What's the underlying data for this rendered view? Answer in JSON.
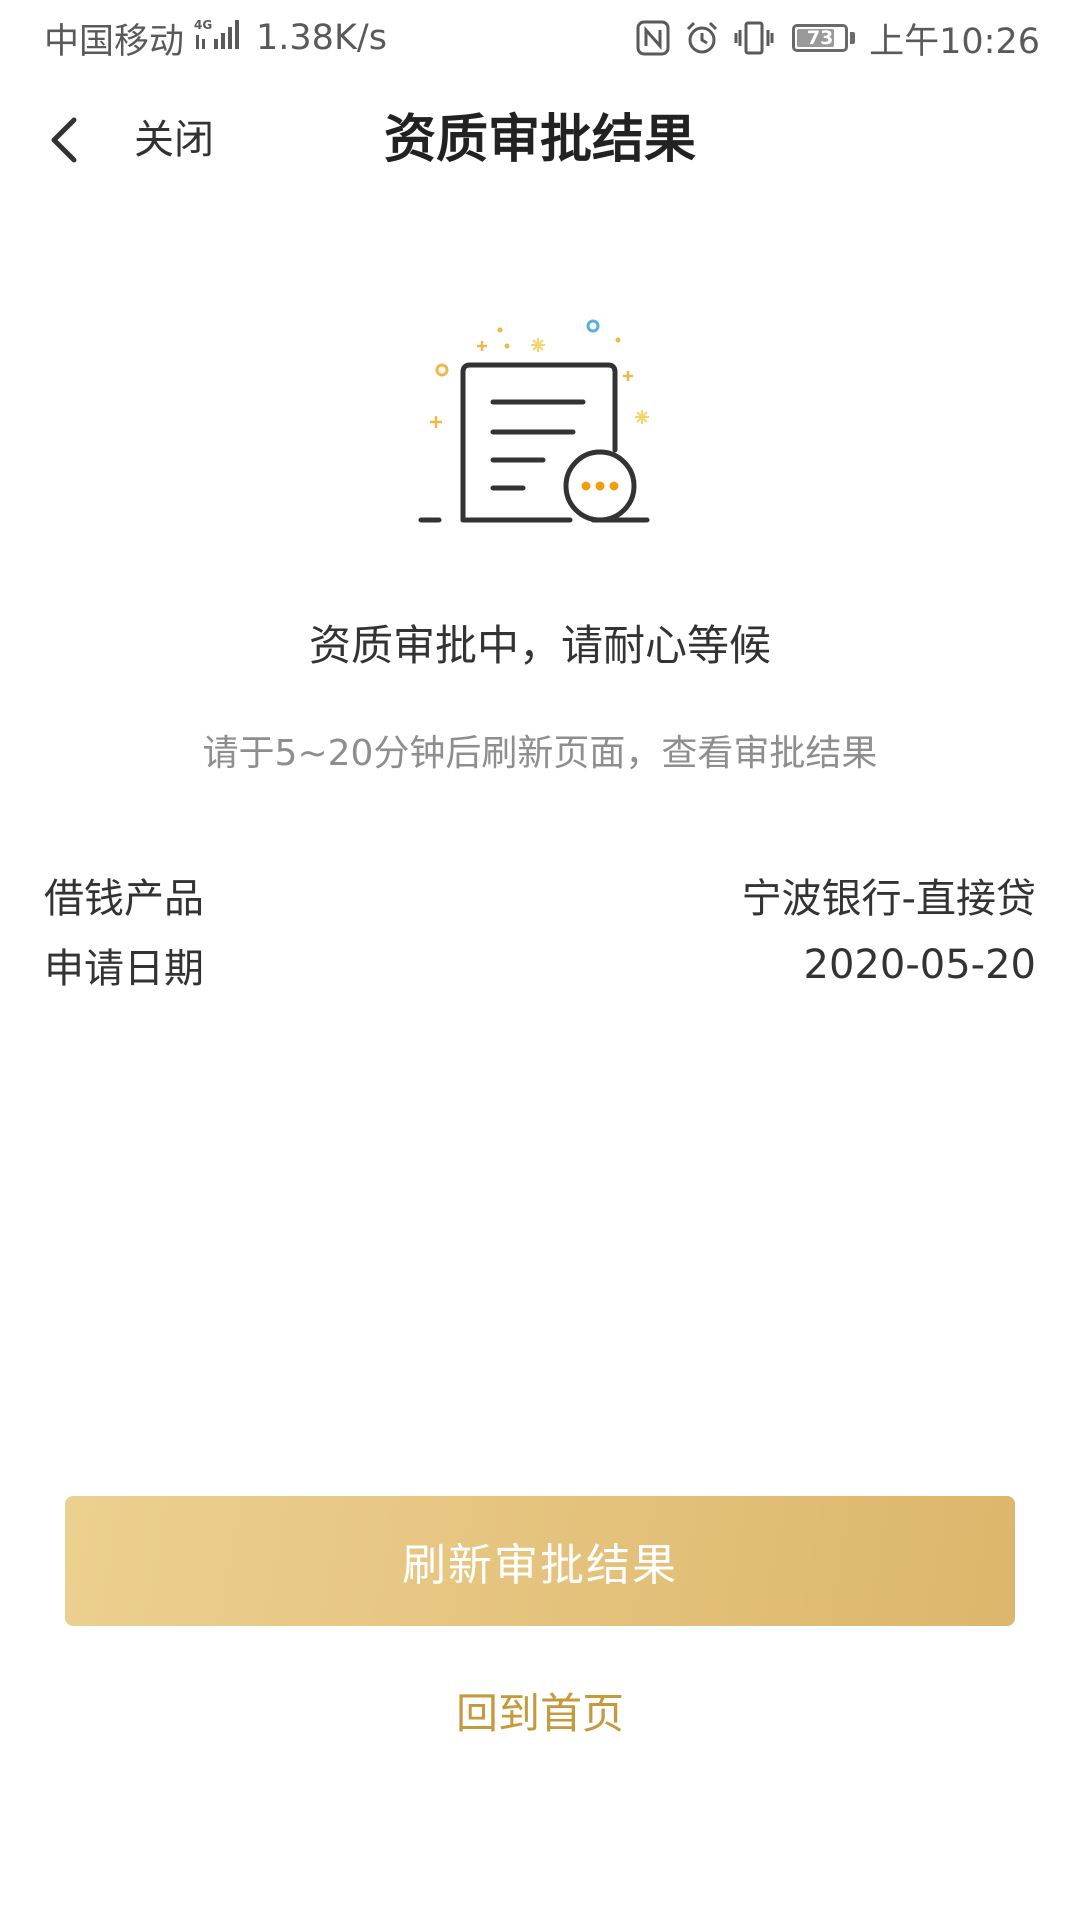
{
  "status_bar": {
    "carrier": "中国移动",
    "network_type": "4G",
    "speed": "1.38K/s",
    "battery_level": "73",
    "time": "上午10:26",
    "icons": [
      "signal-icon",
      "nfc-icon",
      "alarm-icon",
      "vibrate-icon",
      "battery-icon"
    ]
  },
  "nav": {
    "back_icon": "chevron-left-icon",
    "close_label": "关闭",
    "title": "资质审批结果"
  },
  "illustration": {
    "icon": "document-pending-icon",
    "accent_color": "#f39c12"
  },
  "message": {
    "headline": "资质审批中，请耐心等候",
    "hint": "请于5~20分钟后刷新页面，查看审批结果"
  },
  "info": [
    {
      "label": "借钱产品",
      "value": "宁波银行-直接贷"
    },
    {
      "label": "申请日期",
      "value": "2020-05-20"
    }
  ],
  "actions": {
    "refresh_label": "刷新审批结果",
    "home_label": "回到首页"
  },
  "colors": {
    "button_gradient_start": "#ecd08f",
    "button_gradient_end": "#dcb66b",
    "link": "#c49a3c",
    "hint_text": "#8e8e8e"
  }
}
